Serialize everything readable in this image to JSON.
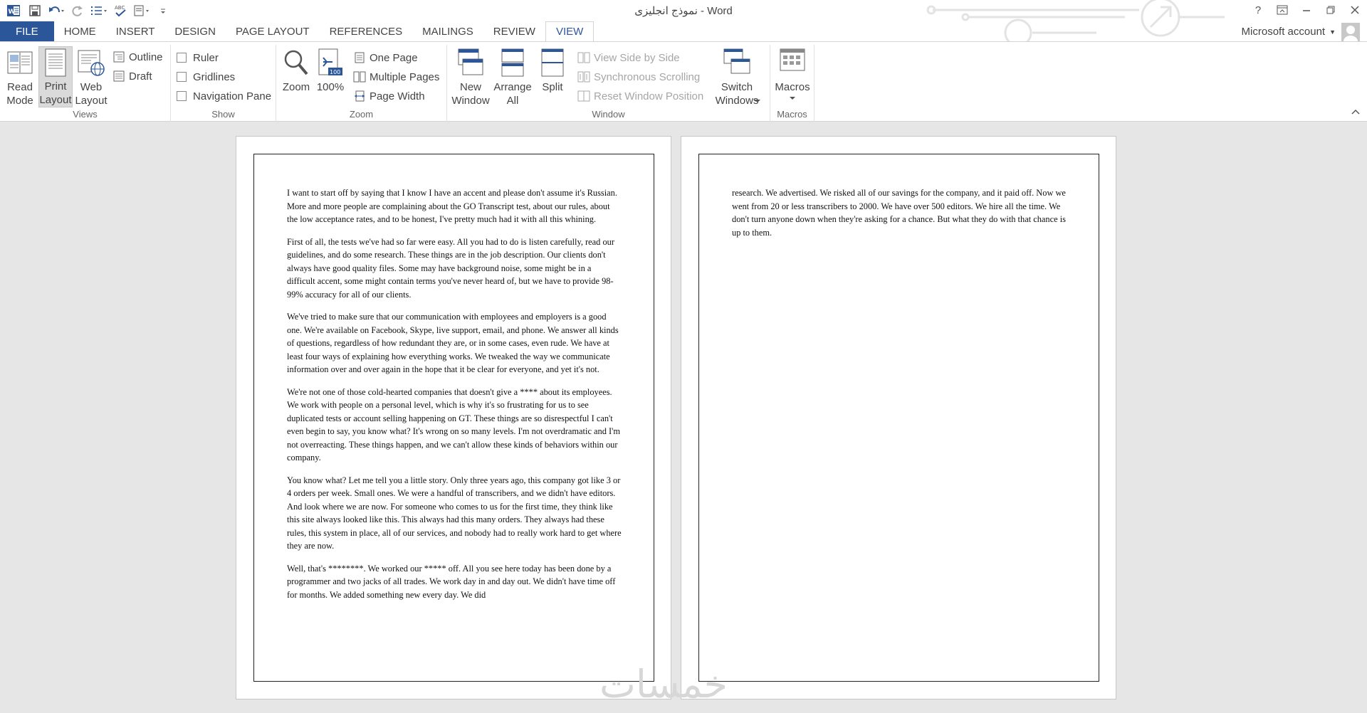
{
  "window": {
    "title": "نموذج انجليزى - Word",
    "help_glyph": "?",
    "account_label": "Microsoft account"
  },
  "tabs": [
    {
      "label": "FILE"
    },
    {
      "label": "HOME"
    },
    {
      "label": "INSERT"
    },
    {
      "label": "DESIGN"
    },
    {
      "label": "PAGE LAYOUT"
    },
    {
      "label": "REFERENCES"
    },
    {
      "label": "MAILINGS"
    },
    {
      "label": "REVIEW"
    },
    {
      "label": "VIEW",
      "active": true
    }
  ],
  "ribbon": {
    "views": {
      "label": "Views",
      "read_mode": "Read Mode",
      "print_layout": "Print Layout",
      "web_layout": "Web Layout",
      "outline": "Outline",
      "draft": "Draft"
    },
    "show": {
      "label": "Show",
      "ruler": "Ruler",
      "gridlines": "Gridlines",
      "navigation_pane": "Navigation Pane"
    },
    "zoom": {
      "label": "Zoom",
      "zoom": "Zoom",
      "hundred": "100%",
      "icon_badge": "100",
      "one_page": "One Page",
      "multiple_pages": "Multiple Pages",
      "page_width": "Page Width"
    },
    "window": {
      "label": "Window",
      "new_window": "New Window",
      "arrange_all": "Arrange All",
      "split": "Split",
      "view_side_by_side": "View Side by Side",
      "synchronous_scrolling": "Synchronous Scrolling",
      "reset_window_position": "Reset Window Position",
      "switch_windows": "Switch Windows"
    },
    "macros": {
      "label": "Macros",
      "macros": "Macros"
    }
  },
  "document": {
    "page1": [
      "I want to start off by saying that I know I have an accent and please don't assume it's Russian. More and more people are complaining about the GO Transcript test, about our rules, about the low acceptance rates, and to be honest, I've pretty much had it with all this whining.",
      "First of all, the tests we've had so far were easy. All you had to do is listen carefully, read our guidelines, and do some research. These things are in the job description. Our clients don't always have good quality files. Some may have background noise, some might be in a difficult accent, some might contain terms you've never heard of, but we have to provide 98-99% accuracy for all of our clients.",
      "We've tried to make sure that our communication with employees and employers is a good one. We're available on Facebook, Skype, live support, email, and phone. We answer all kinds of questions, regardless of how redundant they are, or in some cases, even rude. We have at least four ways of explaining how everything works. We tweaked the way we communicate information over and over again in the hope that it be clear for everyone, and yet it's not.",
      "We're not one of those cold-hearted companies that doesn't give a **** about its employees. We work with people on a personal level, which is why it's so frustrating for us to see duplicated tests or account selling happening on GT. These things are so disrespectful I can't even begin to say, you know what? It's wrong on so many levels. I'm not overdramatic and I'm not overreacting. These things happen, and we can't allow these kinds of behaviors within our company.",
      "You know what? Let me tell you a little story. Only three years ago, this company got like 3 or 4 orders per week. Small ones. We were a handful of transcribers, and we didn't have editors. And look where we are now. For someone who comes to us for the first time, they think like this site always looked like this. This always had this many orders. They always had these rules, this system in place, all of our services, and nobody had to really work hard to get where they are now.",
      "Well, that's ********. We worked our ***** off. All you see here today has been done by a programmer and two jacks of all trades. We work day in and day out. We didn't have time off for months. We added something new every day. We did"
    ],
    "page2": [
      "research. We advertised. We risked all of our savings for the company, and it paid off. Now we went from 20 or less transcribers to 2000. We have over 500 editors. We hire all the time. We don't turn anyone down when they're asking for a chance. But what they do with that chance is up to them."
    ]
  },
  "watermark": "خمسات",
  "colors": {
    "accent": "#2b579a",
    "doc_background": "#e6e6e6"
  }
}
